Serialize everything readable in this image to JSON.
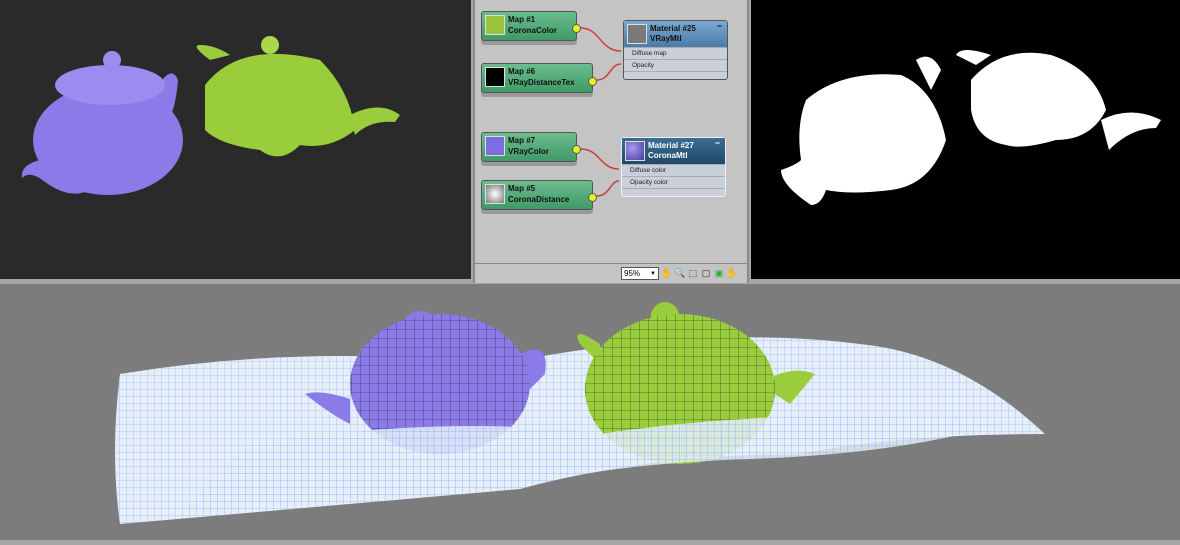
{
  "node_editor": {
    "maps": [
      {
        "id": "Map #1",
        "type": "CoronaColor",
        "swatch": "#9cc43c"
      },
      {
        "id": "Map #6",
        "type": "VRayDistanceTex",
        "swatch": "#000000"
      },
      {
        "id": "Map #7",
        "type": "VRayColor",
        "swatch": "#7b6ee0"
      },
      {
        "id": "Map #5",
        "type": "CoronaDistance",
        "swatch": "#e8e8e8"
      }
    ],
    "materials": [
      {
        "id": "Material #25",
        "type": "VRayMtl",
        "slots": [
          "Diffuse map",
          "Opacity"
        ],
        "header_color": "#5a8cb8"
      },
      {
        "id": "Material #27",
        "type": "CoronaMtl",
        "slots": [
          "Diffuse color",
          "Opacity color"
        ],
        "header_color": "#2c5c7e"
      }
    ],
    "zoom": "95%",
    "collapse_label": "−"
  },
  "colors": {
    "purple": "#8a7be8",
    "green": "#9acd3c",
    "wire": "#7ab0ff"
  }
}
